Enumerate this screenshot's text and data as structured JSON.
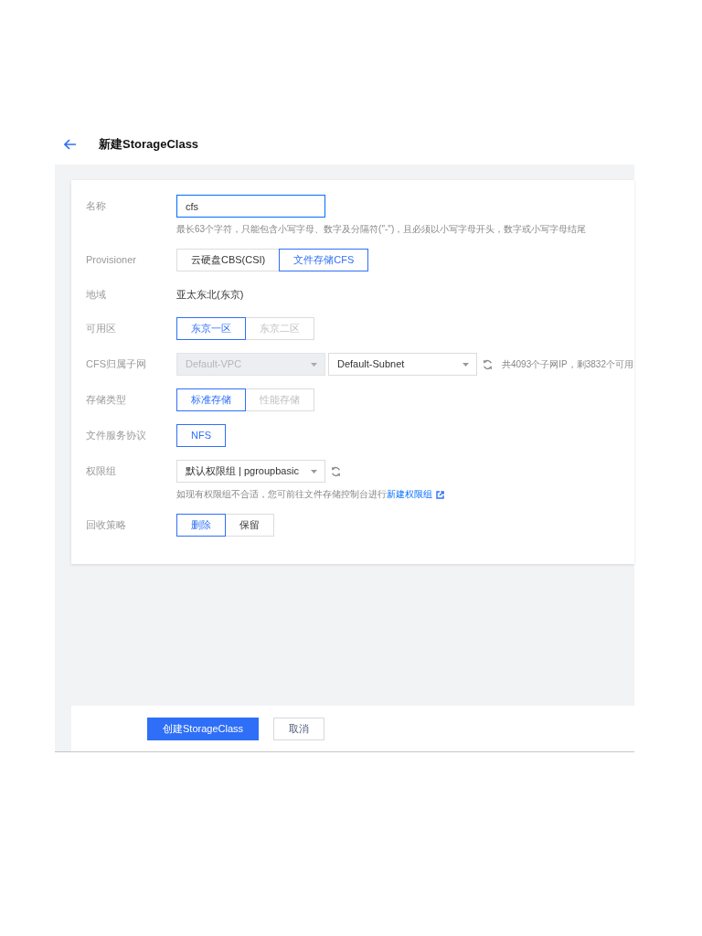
{
  "header": {
    "title": "新建StorageClass"
  },
  "form": {
    "fields": [
      {
        "kind": "input",
        "label": "名称",
        "value": "cfs",
        "focused": true,
        "hint": "最长63个字符，只能包含小写字母、数字及分隔符(\"-\")，且必须以小写字母开头，数字或小写字母结尾"
      },
      {
        "kind": "segmented",
        "label": "Provisioner",
        "options": [
          {
            "label": "云硬盘CBS(CSI)",
            "selected": false,
            "disabled": false
          },
          {
            "label": "文件存储CFS",
            "selected": true,
            "disabled": false
          }
        ]
      },
      {
        "kind": "text",
        "label": "地域",
        "value": "亚太东北(东京)"
      },
      {
        "kind": "segmented",
        "label": "可用区",
        "options": [
          {
            "label": "东京一区",
            "selected": true,
            "disabled": false
          },
          {
            "label": "东京二区",
            "selected": false,
            "disabled": true
          }
        ]
      },
      {
        "kind": "selects",
        "label": "CFS归属子网",
        "selects": [
          {
            "value": "Default-VPC",
            "disabled": true
          },
          {
            "value": "Default-Subnet",
            "disabled": false
          }
        ],
        "note": "共4093个子网IP，剩3832个可用"
      },
      {
        "kind": "segmented",
        "label": "存储类型",
        "options": [
          {
            "label": "标准存储",
            "selected": true,
            "disabled": false
          },
          {
            "label": "性能存储",
            "selected": false,
            "disabled": true
          }
        ]
      },
      {
        "kind": "segmented",
        "label": "文件服务协议",
        "options": [
          {
            "label": "NFS",
            "selected": true,
            "disabled": false
          }
        ]
      },
      {
        "kind": "selects",
        "label": "权限组",
        "selects": [
          {
            "value": "默认权限组 | pgroupbasic",
            "disabled": false
          }
        ],
        "hint": "如现有权限组不合适，您可前往文件存储控制台进行",
        "hint_link": "新建权限组"
      },
      {
        "kind": "segmented",
        "label": "回收策略",
        "options": [
          {
            "label": "删除",
            "selected": true,
            "disabled": false
          },
          {
            "label": "保留",
            "selected": false,
            "disabled": false
          }
        ]
      }
    ]
  },
  "footer": {
    "buttons": [
      {
        "label": "创建StorageClass",
        "kind": "primary"
      },
      {
        "label": "取消",
        "kind": "secondary"
      }
    ]
  }
}
